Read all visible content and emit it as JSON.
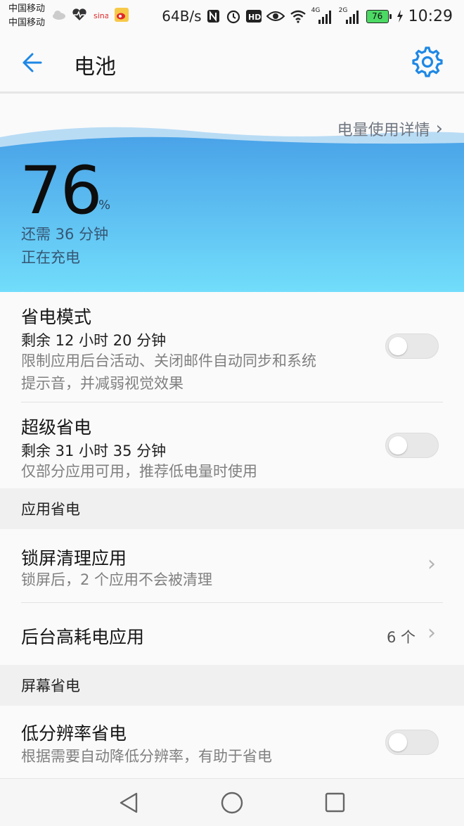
{
  "status_bar": {
    "carrier_1": "中国移动",
    "carrier_2": "中国移动",
    "net_speed": "64B/s",
    "signal_1": "4G",
    "signal_2": "2G",
    "battery_level": "76",
    "time": "10:29"
  },
  "app_bar": {
    "title": "电池"
  },
  "battery": {
    "details_link": "电量使用详情",
    "percent": "76",
    "percent_unit": "%",
    "remaining": "还需 36 分钟",
    "status": "正在充电",
    "gradient_top": "#4aa3e8",
    "gradient_bottom": "#72ddfb"
  },
  "power_saving": {
    "title": "省电模式",
    "remaining": "剩余 12 小时 20 分钟",
    "desc_line1": "限制应用后台活动、关闭邮件自动同步和系统",
    "desc_line2": "提示音，并减弱视觉效果",
    "enabled": false
  },
  "ultra_saving": {
    "title": "超级省电",
    "remaining": "剩余 31 小时 35 分钟",
    "desc": "仅部分应用可用，推荐低电量时使用",
    "enabled": false
  },
  "app_saving": {
    "header": "应用省电",
    "lockscreen_cleanup": {
      "title": "锁屏清理应用",
      "desc": "锁屏后，2 个应用不会被清理"
    },
    "background_high": {
      "title": "后台高耗电应用",
      "count": "6 个"
    }
  },
  "screen_saving": {
    "header": "屏幕省电",
    "low_res": {
      "title": "低分辨率省电",
      "desc": "根据需要自动降低分辨率，有助于省电",
      "enabled": false
    }
  },
  "colors": {
    "accent": "#1e88e5"
  }
}
